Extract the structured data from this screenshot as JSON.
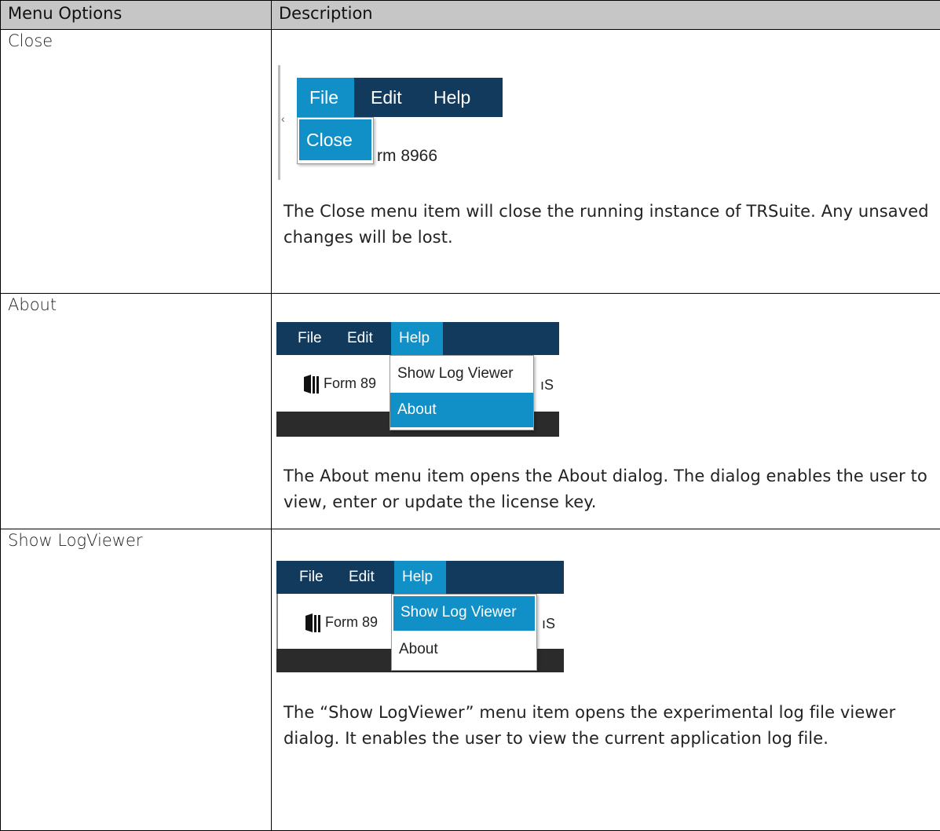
{
  "table": {
    "headers": [
      "Menu Options",
      "Description"
    ],
    "rows": [
      {
        "option": "Close",
        "description": "The Close menu item will close the running instance of TRSuite. Any unsaved changes will be lost.",
        "shot": {
          "menu": [
            "File",
            "Edit",
            "Help"
          ],
          "dropdown": [
            "Close"
          ],
          "behind_text": "rm 8966"
        }
      },
      {
        "option": "About",
        "description": "The About menu item opens the About dialog. The dialog enables the user to view, enter or update the license key.",
        "shot": {
          "menu": [
            "File",
            "Edit",
            "Help"
          ],
          "dropdown": [
            "Show Log Viewer",
            "About"
          ],
          "behind_text": "Form 89",
          "behind_suffix": "ıS"
        }
      },
      {
        "option": "Show LogViewer",
        "description": "The “Show LogViewer” menu item opens the experimental log file viewer dialog. It enables the user to view the current application log file.",
        "shot": {
          "menu": [
            "File",
            "Edit",
            "Help"
          ],
          "dropdown": [
            "Show Log Viewer",
            "About"
          ],
          "behind_text": "Form 89",
          "behind_suffix": "ıS"
        }
      }
    ]
  },
  "colors": {
    "header_bg": "#c6c6c6",
    "menubar": "#123a5c",
    "highlight": "#1190c8",
    "dark_strip": "#2b2b2b"
  }
}
